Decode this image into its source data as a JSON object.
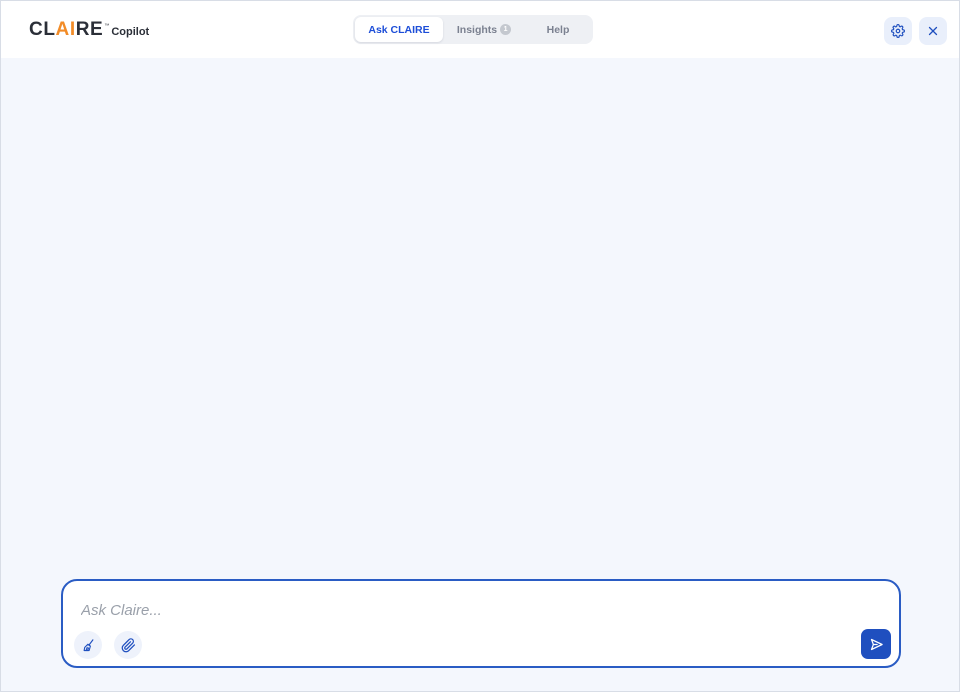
{
  "brand": {
    "name_prefix": "CL",
    "name_accent": "AI",
    "name_suffix": "RE",
    "trademark": "™",
    "product": "Copilot",
    "accent_color": "#f28c28"
  },
  "tabs": [
    {
      "label": "Ask CLAIRE",
      "active": true
    },
    {
      "label": "Insights",
      "active": false,
      "badge": "1"
    },
    {
      "label": "Help",
      "active": false
    }
  ],
  "header_actions": {
    "settings_icon": "gear-icon",
    "close_icon": "close-icon"
  },
  "chat": {
    "placeholder": "Ask Claire...",
    "value": "",
    "clear_icon": "broom-icon",
    "attach_icon": "paperclip-icon",
    "send_icon": "send-icon",
    "border_color": "#2a5cc4",
    "send_color": "#1f4fbf"
  }
}
